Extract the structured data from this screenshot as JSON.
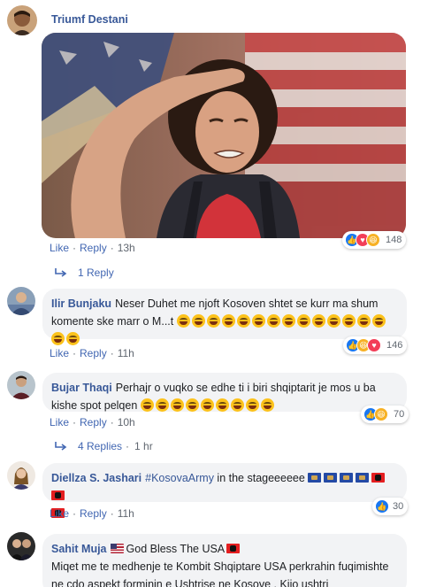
{
  "comments": [
    {
      "author": "Triumf Destani",
      "actions": {
        "like": "Like",
        "reply": "Reply",
        "time": "13h"
      },
      "reactions": {
        "count": "148"
      },
      "replies_link": "1 Reply"
    },
    {
      "author": "Ilir Bunjaku",
      "text": "Neser Duhet me njoft Kosoven shtet se kurr ma shum komente ske marr o M...t",
      "emoji_count": 16,
      "actions": {
        "like": "Like",
        "reply": "Reply",
        "time": "11h"
      },
      "reactions": {
        "count": "146"
      }
    },
    {
      "author": "Bujar Thaqi",
      "text": "Perhajr o vuqko se edhe ti i biri shqiptarit je mos u ba kishe spot pelqen",
      "emoji_count": 9,
      "actions": {
        "like": "Like",
        "reply": "Reply",
        "time": "10h"
      },
      "reactions": {
        "count": "70"
      },
      "replies_link": "4 Replies",
      "replies_time": "1 hr"
    },
    {
      "author": "Diellza S. Jashari",
      "hashtag": "#KosovaArmy",
      "text": " in the stageeeeee",
      "actions": {
        "like": "Like",
        "reply": "Reply",
        "time": "11h"
      },
      "reactions": {
        "count": "30"
      }
    },
    {
      "author": "Sahit Muja",
      "heading": "God Bless The USA",
      "text": "Miqet me te medhenje te Kombit Shqiptare USA perkrahin fuqimishte ne çdo aspekt forminin e Ushtrise ne Kosove . Kijo ushtri"
    }
  ],
  "colors": {
    "link": "#4267b2",
    "name": "#385898",
    "bubble": "#f2f3f5",
    "meta": "#606770"
  }
}
